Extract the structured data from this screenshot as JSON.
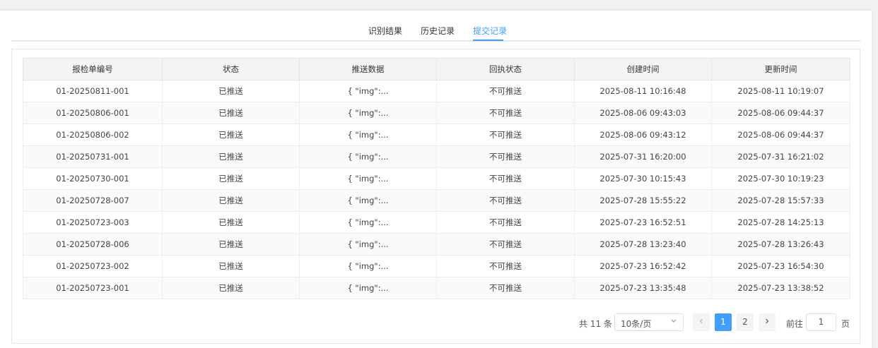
{
  "tabs": [
    "识别结果",
    "历史记录",
    "提交记录"
  ],
  "active_tab": 2,
  "table": {
    "headers": [
      "报检单编号",
      "状态",
      "推送数据",
      "回执状态",
      "创建时间",
      "更新时间"
    ],
    "rows": [
      [
        "01-20250811-001",
        "已推送",
        "{ \"img\":...",
        "不可推送",
        "2025-08-11 10:16:48",
        "2025-08-11 10:19:07"
      ],
      [
        "01-20250806-001",
        "已推送",
        "{ \"img\":...",
        "不可推送",
        "2025-08-06 09:43:03",
        "2025-08-06 09:44:37"
      ],
      [
        "01-20250806-002",
        "已推送",
        "{ \"img\":...",
        "不可推送",
        "2025-08-06 09:43:12",
        "2025-08-06 09:44:37"
      ],
      [
        "01-20250731-001",
        "已推送",
        "{ \"img\":...",
        "不可推送",
        "2025-07-31 16:20:00",
        "2025-07-31 16:21:02"
      ],
      [
        "01-20250730-001",
        "已推送",
        "{ \"img\":...",
        "不可推送",
        "2025-07-30 10:15:43",
        "2025-07-30 10:19:23"
      ],
      [
        "01-20250728-007",
        "已推送",
        "{ \"img\":...",
        "不可推送",
        "2025-07-28 15:55:22",
        "2025-07-28 15:57:33"
      ],
      [
        "01-20250723-003",
        "已推送",
        "{ \"img\":...",
        "不可推送",
        "2025-07-23 16:52:51",
        "2025-07-28 14:25:13"
      ],
      [
        "01-20250728-006",
        "已推送",
        "{ \"img\":...",
        "不可推送",
        "2025-07-28 13:23:40",
        "2025-07-28 13:26:43"
      ],
      [
        "01-20250723-002",
        "已推送",
        "{ \"img\":...",
        "不可推送",
        "2025-07-23 16:52:42",
        "2025-07-23 16:54:30"
      ],
      [
        "01-20250723-001",
        "已推送",
        "{ \"img\":...",
        "不可推送",
        "2025-07-23 13:35:48",
        "2025-07-23 13:38:52"
      ]
    ]
  },
  "pagination": {
    "total_text": "共 11 条",
    "page_size": "10条/页",
    "pages": [
      "1",
      "2"
    ],
    "current_page": "1",
    "goto_label": "前往",
    "goto_value": "1",
    "page_unit": "页",
    "prev_icon": "chevron-left-icon",
    "next_icon": "chevron-right-icon",
    "dropdown_icon": "chevron-down-icon"
  },
  "colors": {
    "accent": "#409eff",
    "header_bg": "#f3f4f6",
    "stripe_bg": "#fafafa"
  }
}
